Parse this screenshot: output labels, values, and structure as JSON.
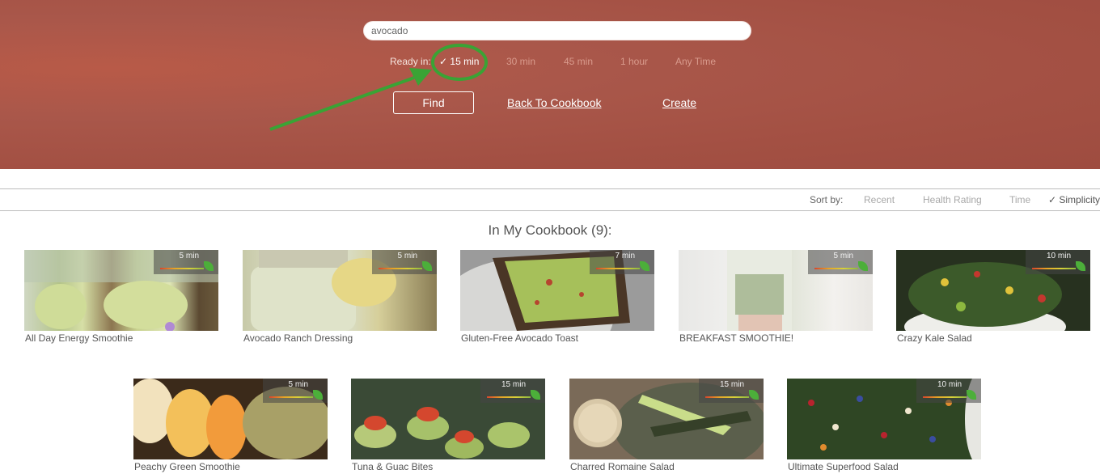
{
  "search": {
    "value": "avocado"
  },
  "ready_in": {
    "label": "Ready in:",
    "options": [
      "✓ 15 min",
      "30 min",
      "45 min",
      "1 hour",
      "Any Time"
    ],
    "selected": "15 min"
  },
  "actions": {
    "find": "Find",
    "back": "Back To Cookbook",
    "create": "Create"
  },
  "sort": {
    "label": "Sort by:",
    "options": [
      "Recent",
      "Health Rating",
      "Time",
      "✓ Simplicity"
    ],
    "selected": "Simplicity"
  },
  "section_title": "In My Cookbook (9):",
  "recipes": [
    {
      "name": "All Day Energy Smoothie",
      "time": "5 min"
    },
    {
      "name": "Avocado Ranch Dressing",
      "time": "5 min"
    },
    {
      "name": "Gluten-Free Avocado Toast",
      "time": "7 min"
    },
    {
      "name": "BREAKFAST SMOOTHIE!",
      "time": "5 min"
    },
    {
      "name": "Crazy Kale Salad",
      "time": "10 min"
    },
    {
      "name": "Peachy Green Smoothie",
      "time": "5 min"
    },
    {
      "name": "Tuna & Guac Bites",
      "time": "15 min"
    },
    {
      "name": "Charred Romaine Salad",
      "time": "15 min"
    },
    {
      "name": "Ultimate Superfood Salad",
      "time": "10 min"
    }
  ],
  "colors": {
    "hero": "#a9574a",
    "annotation": "#3aa335",
    "leaf": "#4caf3a"
  }
}
